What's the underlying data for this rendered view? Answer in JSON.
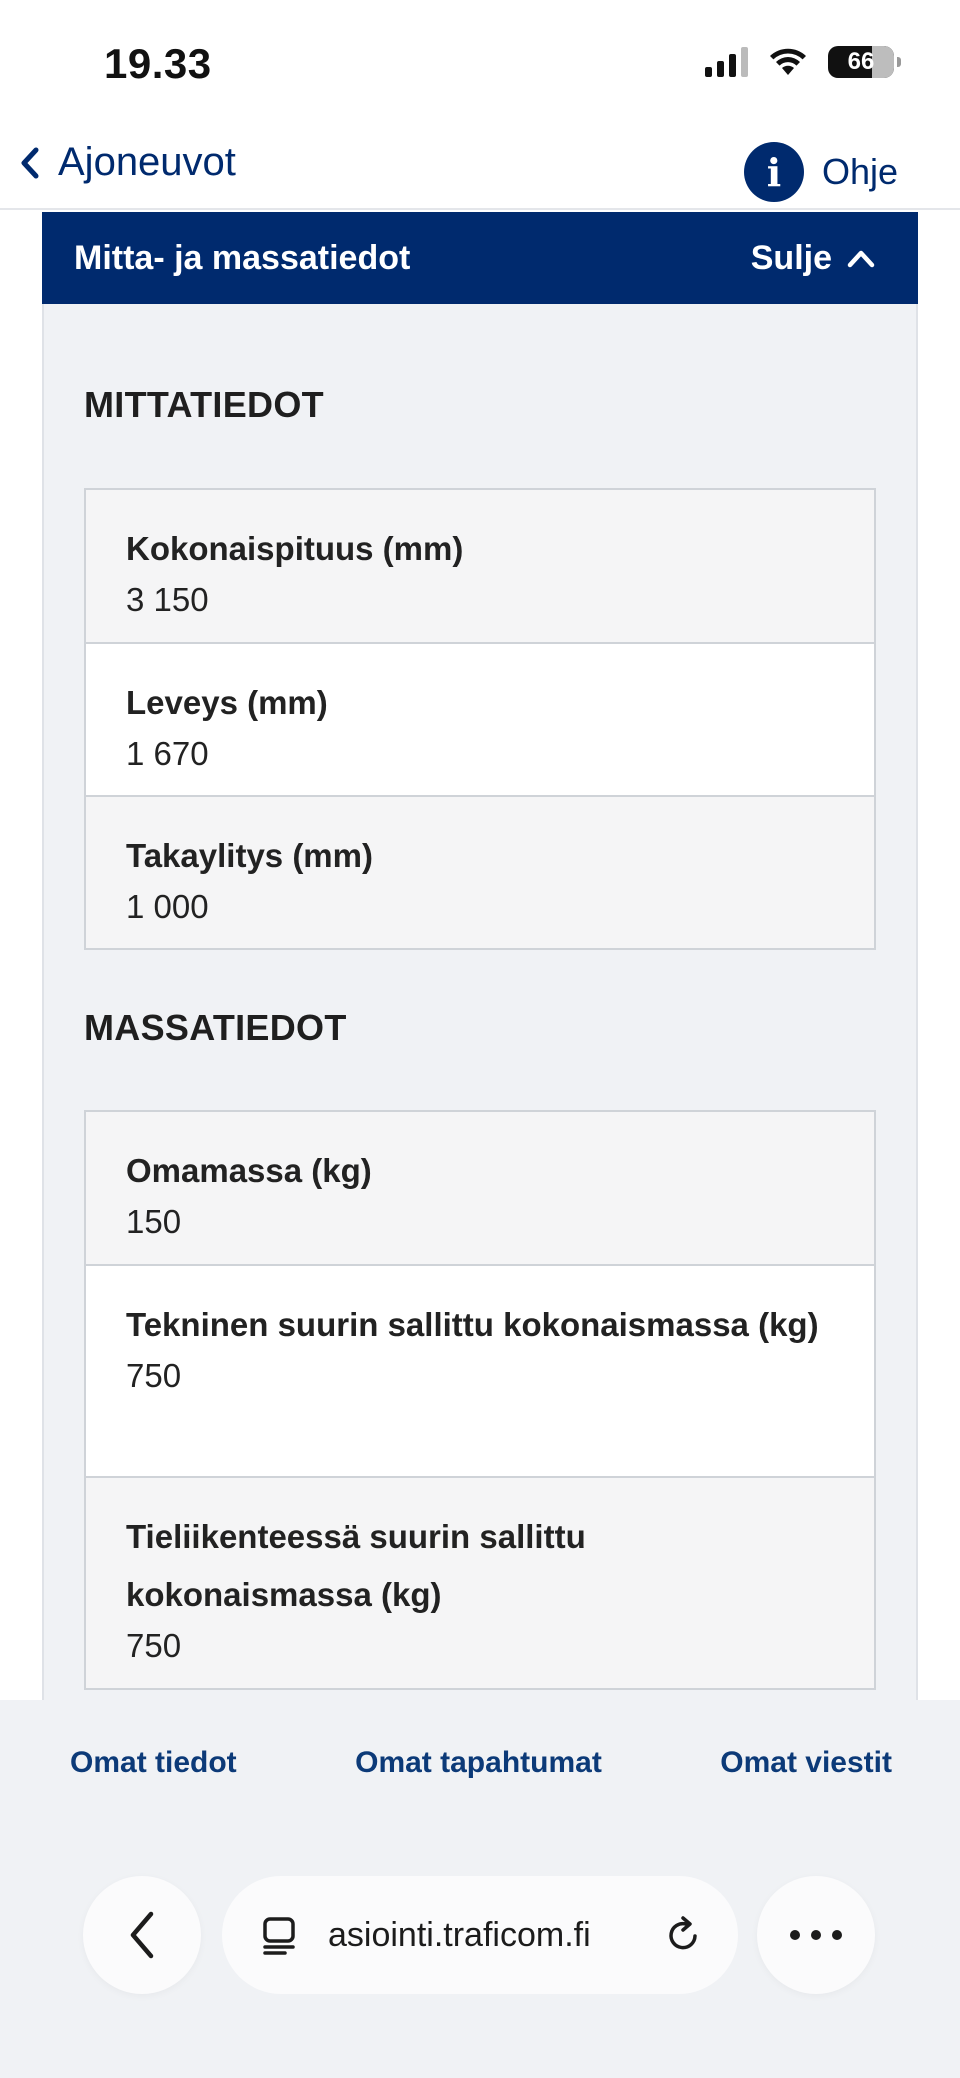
{
  "status_bar": {
    "time": "19.33",
    "battery": "66"
  },
  "nav": {
    "back_label": "Ajoneuvot",
    "help_label": "Ohje",
    "info_glyph": "i"
  },
  "panel": {
    "title": "Mitta- ja massatiedot",
    "toggle_label": "Sulje"
  },
  "sections": {
    "dimensions": {
      "heading": "MITTATIEDOT",
      "fields": [
        {
          "label": "Kokonaispituus (mm)",
          "value": "3 150"
        },
        {
          "label": "Leveys (mm)",
          "value": "1 670"
        },
        {
          "label": "Takaylitys (mm)",
          "value": "1 000"
        }
      ]
    },
    "masses": {
      "heading": "MASSATIEDOT",
      "fields": [
        {
          "label": "Omamassa (kg)",
          "value": "150"
        },
        {
          "label": "Tekninen suurin sallittu kokonaismassa (kg)",
          "value": "750"
        },
        {
          "label": "Tieliikenteessä suurin sallittu kokonaismassa (kg)",
          "value": "750"
        }
      ]
    }
  },
  "bottom_tabs": {
    "own_info": "Omat tiedot",
    "own_events": "Omat tapahtumat",
    "own_messages": "Omat viestit"
  },
  "browser": {
    "url": "asiointi.traficom.fi"
  },
  "colors": {
    "brand_navy": "#002a6e",
    "panel_bg": "#f0f2f5"
  }
}
